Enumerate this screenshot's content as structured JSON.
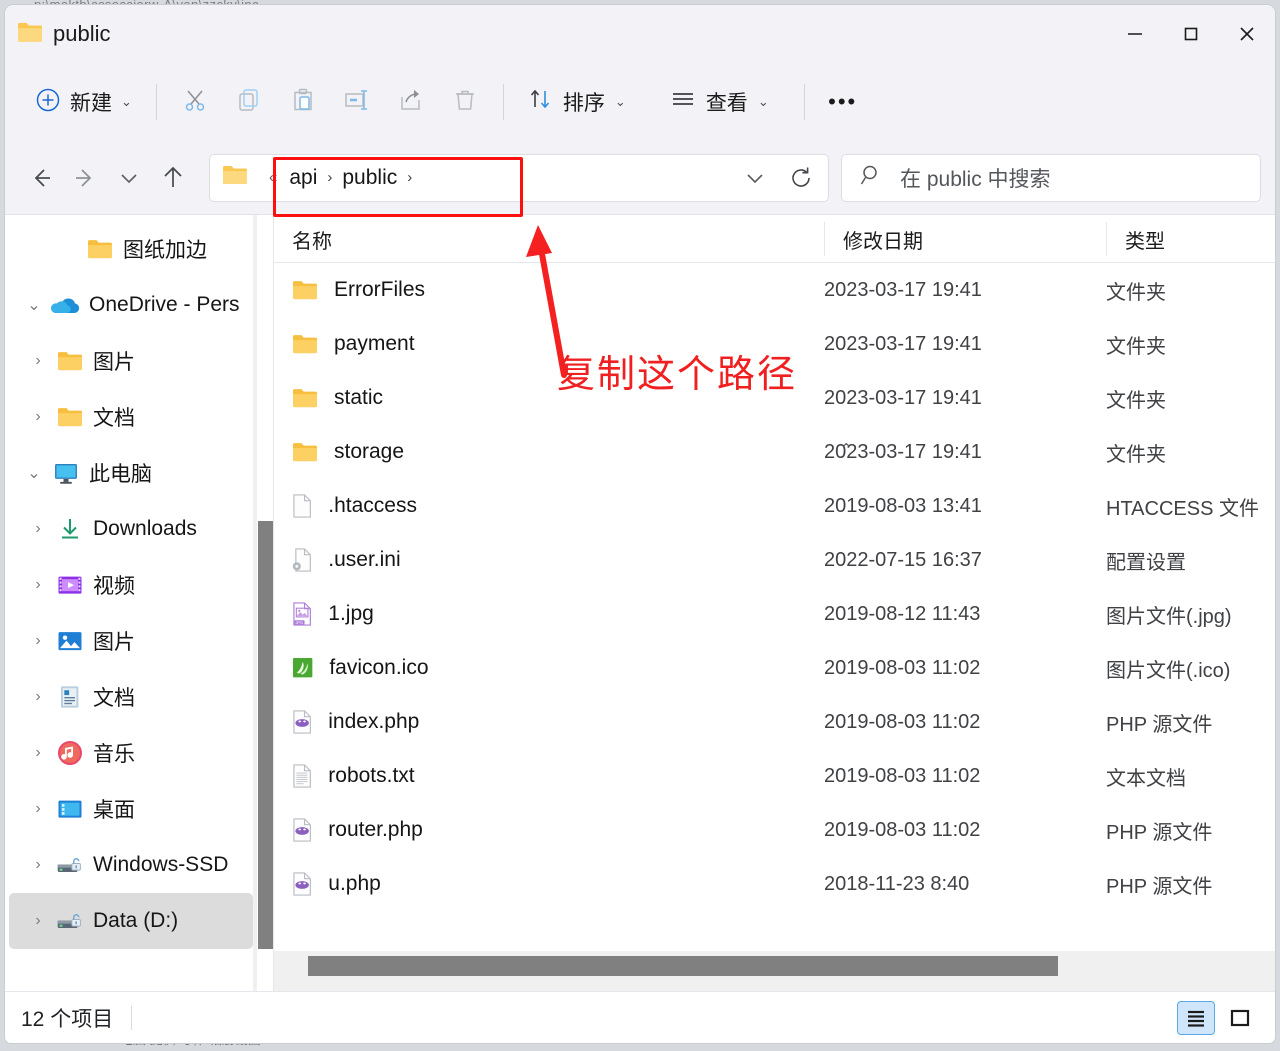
{
  "background": {
    "top_cut_text": "p:\\makth\\ccsocciorw-A\\van\\zzcky\\inc",
    "bottom_cut_text": "电脑           提供                 写作             相册截图"
  },
  "window": {
    "title": "public",
    "title_icon": "folder-icon",
    "controls": {
      "minimize": "—",
      "maximize": "□",
      "close": "✕"
    }
  },
  "toolbar": {
    "new_label": "新建",
    "new_icon": "plus-circle-icon",
    "cut_icon": "scissors-icon",
    "copy_icon": "copy-icon",
    "paste_icon": "paste-icon",
    "rename_icon": "rename-icon",
    "share_icon": "share-icon",
    "delete_icon": "trash-icon",
    "sort_label": "排序",
    "sort_icon": "sort-arrows-icon",
    "view_label": "查看",
    "view_icon": "list-lines-icon",
    "more_label": "•••",
    "chevron": "⌄"
  },
  "addressbar": {
    "back_icon": "arrow-left-icon",
    "forward_icon": "arrow-right-icon",
    "recent_icon": "chevron-down-icon",
    "up_icon": "arrow-up-icon",
    "folder_icon": "folder-icon",
    "overflow": "«",
    "crumbs": [
      "api",
      "public"
    ],
    "separator": "›",
    "dropdown_icon": "chevron-down-icon",
    "refresh_icon": "refresh-icon",
    "highlight_color": "#fb0f0f"
  },
  "search": {
    "icon": "search-icon",
    "placeholder": "在 public 中搜索"
  },
  "sidebar": {
    "items": [
      {
        "label": "图纸加边",
        "icon": "folder-icon",
        "expander": "",
        "indent": 2,
        "selected": false
      },
      {
        "label": "OneDrive - Pers",
        "icon": "onedrive-cloud-icon",
        "expander": "⌄",
        "indent": 0,
        "selected": false
      },
      {
        "label": "图片",
        "icon": "folder-icon",
        "expander": "›",
        "indent": 1,
        "selected": false
      },
      {
        "label": "文档",
        "icon": "folder-icon",
        "expander": "›",
        "indent": 1,
        "selected": false
      },
      {
        "label": "此电脑",
        "icon": "this-pc-icon",
        "expander": "⌄",
        "indent": 0,
        "selected": false
      },
      {
        "label": "Downloads",
        "icon": "downloads-icon",
        "expander": "›",
        "indent": 1,
        "selected": false
      },
      {
        "label": "视频",
        "icon": "videos-icon",
        "expander": "›",
        "indent": 1,
        "selected": false
      },
      {
        "label": "图片",
        "icon": "pictures-icon",
        "expander": "›",
        "indent": 1,
        "selected": false
      },
      {
        "label": "文档",
        "icon": "documents-icon",
        "expander": "›",
        "indent": 1,
        "selected": false
      },
      {
        "label": "音乐",
        "icon": "music-icon",
        "expander": "›",
        "indent": 1,
        "selected": false
      },
      {
        "label": "桌面",
        "icon": "desktop-icon",
        "expander": "›",
        "indent": 1,
        "selected": false
      },
      {
        "label": "Windows-SSD",
        "icon": "drive-bitlocker-icon",
        "expander": "›",
        "indent": 1,
        "selected": false
      },
      {
        "label": "Data (D:)",
        "icon": "drive-bitlocker-icon",
        "expander": "›",
        "indent": 1,
        "selected": true
      }
    ]
  },
  "filelist": {
    "collapse_chevron": "⌃",
    "columns": [
      "名称",
      "修改日期",
      "类型"
    ],
    "rows": [
      {
        "name": "ErrorFiles",
        "date": "2023-03-17 19:41",
        "type": "文件夹",
        "icon": "folder-icon"
      },
      {
        "name": "payment",
        "date": "2023-03-17 19:41",
        "type": "文件夹",
        "icon": "folder-icon"
      },
      {
        "name": "static",
        "date": "2023-03-17 19:41",
        "type": "文件夹",
        "icon": "folder-icon"
      },
      {
        "name": "storage",
        "date": "2023-03-17 19:41",
        "type": "文件夹",
        "icon": "folder-icon"
      },
      {
        "name": ".htaccess",
        "date": "2019-08-03 13:41",
        "type": "HTACCESS 文件",
        "icon": "blank-file-icon"
      },
      {
        "name": ".user.ini",
        "date": "2022-07-15 16:37",
        "type": "配置设置",
        "icon": "config-file-icon"
      },
      {
        "name": "1.jpg",
        "date": "2019-08-12 11:43",
        "type": "图片文件(.jpg)",
        "icon": "jpg-file-icon"
      },
      {
        "name": "favicon.ico",
        "date": "2019-08-03 11:02",
        "type": "图片文件(.ico)",
        "icon": "ico-file-icon"
      },
      {
        "name": "index.php",
        "date": "2019-08-03 11:02",
        "type": "PHP 源文件",
        "icon": "php-file-icon"
      },
      {
        "name": "robots.txt",
        "date": "2019-08-03 11:02",
        "type": "文本文档",
        "icon": "txt-file-icon"
      },
      {
        "name": "router.php",
        "date": "2019-08-03 11:02",
        "type": "PHP 源文件",
        "icon": "php-file-icon"
      },
      {
        "name": "u.php",
        "date": "2018-11-23 8:40",
        "type": "PHP 源文件",
        "icon": "php-file-icon"
      }
    ]
  },
  "statusbar": {
    "item_count": "12 个项目",
    "details_view_icon": "details-view-icon",
    "large_icons_view_icon": "large-icons-view-icon",
    "active_view": "details"
  },
  "annotation": {
    "text": "复制这个路径",
    "color": "#f02020",
    "arrow": "arrow-up-left-icon"
  }
}
